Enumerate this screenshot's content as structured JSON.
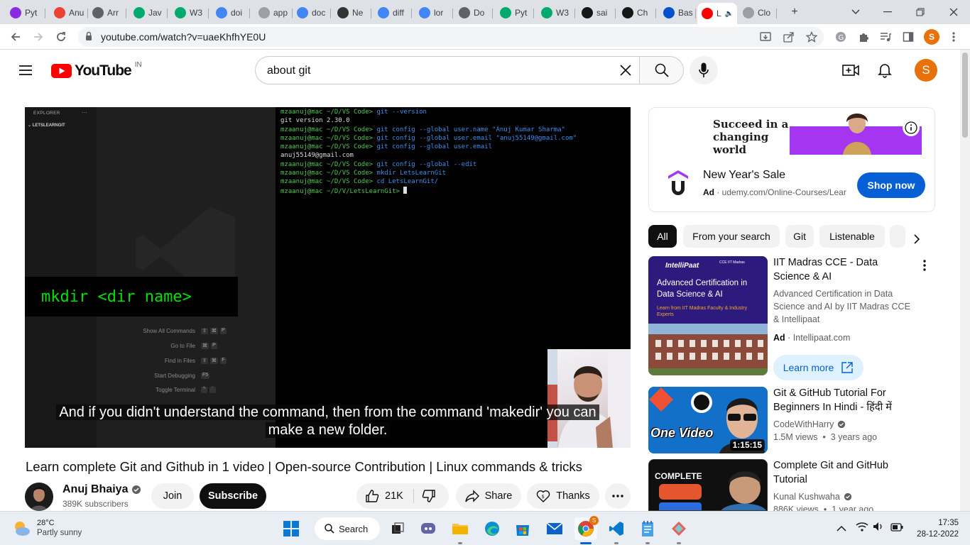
{
  "browser": {
    "tabs": [
      {
        "label": "Pyt",
        "icon": "purple-circle-icon",
        "color": "#8a2be2"
      },
      {
        "label": "Anu",
        "icon": "gmail-icon",
        "color": "#ea4335"
      },
      {
        "label": "Arr",
        "icon": "chrome-icon",
        "color": "#5f6368"
      },
      {
        "label": "Jav",
        "icon": "w3schools-icon",
        "color": "#04aa6d"
      },
      {
        "label": "W3",
        "icon": "w3schools-icon",
        "color": "#04aa6d"
      },
      {
        "label": "doi",
        "icon": "google-icon",
        "color": "#4285f4"
      },
      {
        "label": "app",
        "icon": "loading-icon",
        "color": "#9aa0a6"
      },
      {
        "label": "doc",
        "icon": "google-icon",
        "color": "#4285f4"
      },
      {
        "label": "Ne",
        "icon": "shield-icon",
        "color": "#333333"
      },
      {
        "label": "diff",
        "icon": "google-icon",
        "color": "#4285f4"
      },
      {
        "label": "lor",
        "icon": "google-icon",
        "color": "#4285f4"
      },
      {
        "label": "Do",
        "icon": "chrome-icon",
        "color": "#5f6368"
      },
      {
        "label": "Pyt",
        "icon": "w3schools-icon",
        "color": "#04aa6d"
      },
      {
        "label": "W3",
        "icon": "w3schools-icon",
        "color": "#04aa6d"
      },
      {
        "label": "sai",
        "icon": "github-icon",
        "color": "#181717"
      },
      {
        "label": "Ch",
        "icon": "github-icon",
        "color": "#181717"
      },
      {
        "label": "Bas",
        "icon": "atlassian-icon",
        "color": "#0052cc"
      },
      {
        "label": "L",
        "icon": "youtube-icon",
        "color": "#ff0000",
        "active": true
      },
      {
        "label": "Clo",
        "icon": "loading-icon",
        "color": "#9aa0a6"
      }
    ],
    "new_tab_symbol": "+",
    "url": "youtube.com/watch?v=uaeKhfhYE0U",
    "profile_initial": "S"
  },
  "youtube": {
    "logo_text": "YouTube",
    "region": "IN",
    "search_query": "about git",
    "profile_initial": "S"
  },
  "player": {
    "explorer_title": "EXPLORER",
    "explorer_dots": "···",
    "folder": "LETSLEARNGIT",
    "terminal_lines": [
      {
        "prompt": "mzaanuj@mac ~/D/VS Code> ",
        "cmd": "git --version",
        "plain": ""
      },
      {
        "prompt": "",
        "cmd": "",
        "plain": "git version 2.30.0"
      },
      {
        "prompt": "mzaanuj@mac ~/D/VS Code> ",
        "cmd": "git config --global user.name \"Anuj Kumar Sharma\"",
        "plain": ""
      },
      {
        "prompt": "mzaanuj@mac ~/D/VS Code> ",
        "cmd": "git config --global user.email \"anuj55149@gmail.com\"",
        "plain": ""
      },
      {
        "prompt": "mzaanuj@mac ~/D/VS Code> ",
        "cmd": "git config --global user.email",
        "plain": ""
      },
      {
        "prompt": "",
        "cmd": "",
        "plain": "anuj55149@gmail.com"
      },
      {
        "prompt": "mzaanuj@mac ~/D/VS Code> ",
        "cmd": "git config --global --edit",
        "plain": ""
      },
      {
        "prompt": "mzaanuj@mac ~/D/VS Code> ",
        "cmd": "mkdir LetsLearnGit",
        "plain": ""
      },
      {
        "prompt": "mzaanuj@mac ~/D/VS Code> ",
        "cmd": "cd LetsLearnGit/",
        "plain": ""
      },
      {
        "prompt": "mzaanuj@mac ~/D/V/LetsLearnGit> ",
        "cmd": "",
        "plain": ""
      }
    ],
    "overlay_command": "mkdir <dir name>",
    "shortcuts": [
      {
        "label": "Show All Commands",
        "keys": [
          "⇧",
          "⌘",
          "P"
        ]
      },
      {
        "label": "Go to File",
        "keys": [
          "⌘",
          "P"
        ]
      },
      {
        "label": "Find in Files",
        "keys": [
          "⇧",
          "⌘",
          "F"
        ]
      },
      {
        "label": "Start Debugging",
        "keys": [
          "F5"
        ]
      },
      {
        "label": "Toggle Terminal",
        "keys": [
          "^",
          "`"
        ]
      }
    ],
    "caption_line1": "And if you didn't understand the command, then from the command 'makedir' you can",
    "caption_line2": "make a new folder."
  },
  "video": {
    "title": "Learn complete Git and Github in 1 video | Open-source Contribution | Linux commands & tricks",
    "channel": "Anuj Bhaiya",
    "subscribers": "389K subscribers",
    "join_label": "Join",
    "subscribe_label": "Subscribe",
    "likes": "21K",
    "share_label": "Share",
    "thanks_label": "Thanks"
  },
  "ad": {
    "banner_text": "Succeed in a changing world",
    "title": "New Year's Sale",
    "ad_label": "Ad",
    "domain": "udemy.com/Online-Courses/Lear",
    "cta": "Shop now"
  },
  "chips": [
    "All",
    "From your search",
    "Git",
    "Listenable"
  ],
  "recommendations": [
    {
      "title": "IIT Madras CCE - Data Science & AI",
      "description": "Advanced Certification in Data Science and AI by IIT Madras CCE & Intellipaat",
      "ad_label": "Ad",
      "advertiser": "Intellipaat.com",
      "cta": "Learn more",
      "thumb_brand": "IntelliPaat",
      "thumb_partner": "CCE IIT Madras",
      "thumb_heading": "Advanced Certification in Data Science & AI",
      "thumb_sub": "Learn from IIT Madras Faculty & Industry Experts"
    },
    {
      "title": "Git & GitHub Tutorial For Beginners In Hindi - हिंदी में",
      "channel": "CodeWithHarry",
      "meta": "1.5M views  •  3 years ago",
      "duration": "1:15:15",
      "thumb_text": "One Video"
    },
    {
      "title": "Complete Git and GitHub Tutorial",
      "channel": "Kunal Kushwaha",
      "meta": "886K views  •  1 year ago",
      "thumb_text": "COMPLETE"
    }
  ],
  "taskbar": {
    "temperature": "28°C",
    "weather": "Partly sunny",
    "search_label": "Search",
    "time": "17:35",
    "date": "28-12-2022"
  }
}
